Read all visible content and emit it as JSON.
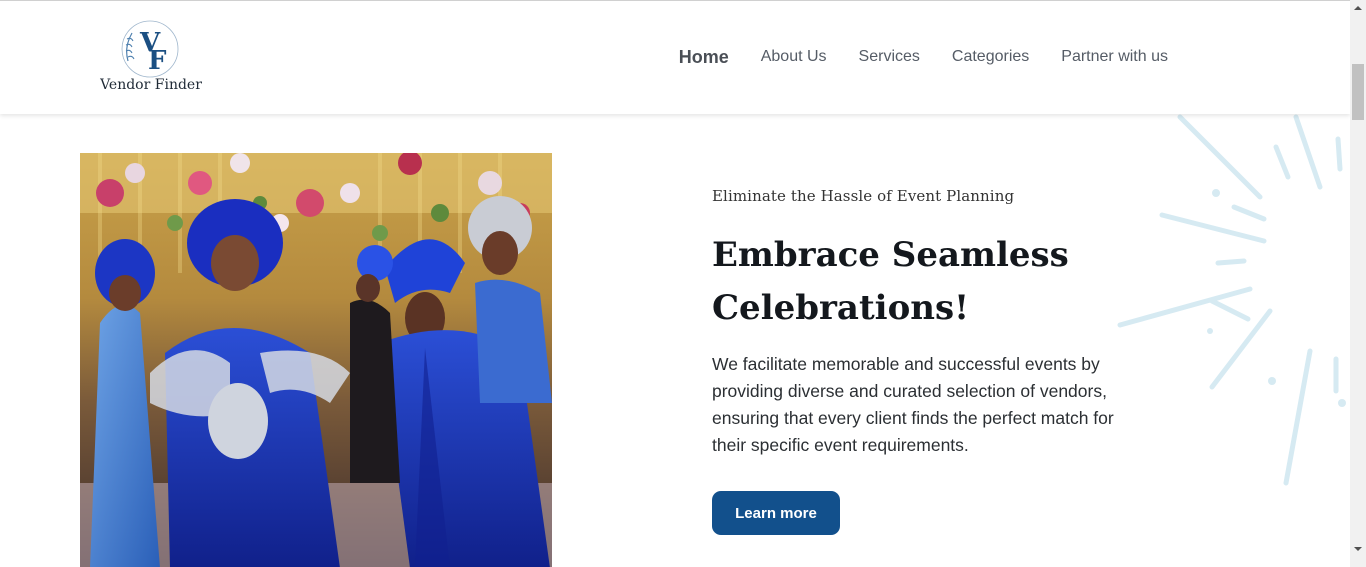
{
  "brand": {
    "name": "Vendor Finder",
    "monogram": "VF",
    "primary_color": "#12508c"
  },
  "nav": {
    "items": [
      {
        "label": "Home",
        "active": true
      },
      {
        "label": "About Us",
        "active": false
      },
      {
        "label": "Services",
        "active": false
      },
      {
        "label": "Categories",
        "active": false
      },
      {
        "label": "Partner with us",
        "active": false
      }
    ]
  },
  "hero": {
    "eyebrow": "Eliminate the Hassle of Event Planning",
    "headline": "Embrace Seamless Celebrations!",
    "description": "We facilitate memorable and successful events by providing diverse and curated selection of vendors, ensuring that every client finds the perfect match for their specific event requirements.",
    "cta_label": "Learn more",
    "image_icon": "celebration-photo"
  }
}
